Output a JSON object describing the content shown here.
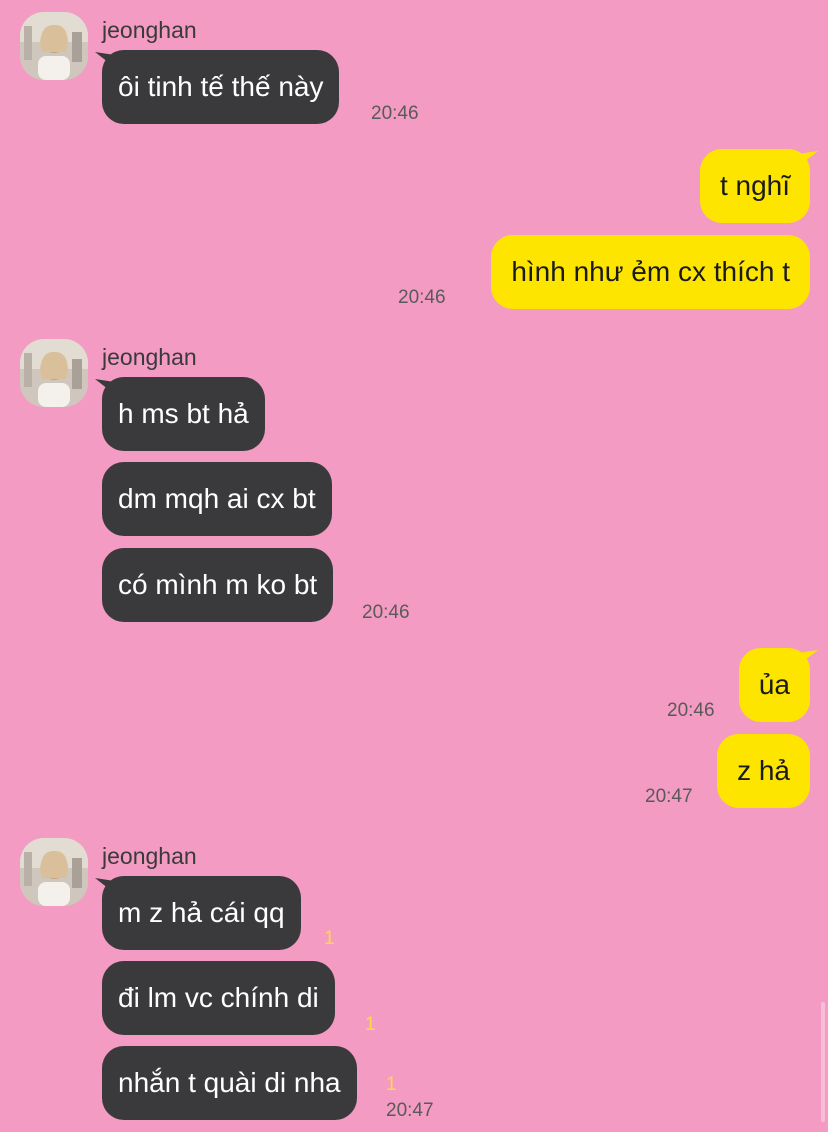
{
  "colors": {
    "background": "#f39bc2",
    "incoming_bubble": "#3a3a3c",
    "outgoing_bubble": "#fee500",
    "unread_count": "#ffd84a"
  },
  "groups": [
    {
      "sender": "jeonghan",
      "messages": [
        {
          "text": "ôi tinh tế thế này",
          "time": "20:46"
        }
      ]
    },
    {
      "messages": [
        {
          "text": "t nghĩ"
        },
        {
          "text": "hình như ẻm cx thích t",
          "time": "20:46"
        }
      ]
    },
    {
      "sender": "jeonghan",
      "messages": [
        {
          "text": "h ms bt hả"
        },
        {
          "text": "dm mqh ai cx bt"
        },
        {
          "text": "có mình m ko bt",
          "time": "20:46"
        }
      ]
    },
    {
      "messages": [
        {
          "text": "ủa",
          "time": "20:46"
        },
        {
          "text": "z hả",
          "time": "20:47"
        }
      ]
    },
    {
      "sender": "jeonghan",
      "messages": [
        {
          "text": "m z hả cái qq",
          "unread": "1"
        },
        {
          "text": "đi lm vc chính di",
          "unread": "1"
        },
        {
          "text": "nhắn t quài di nha",
          "unread": "1",
          "time": "20:47"
        }
      ]
    }
  ]
}
